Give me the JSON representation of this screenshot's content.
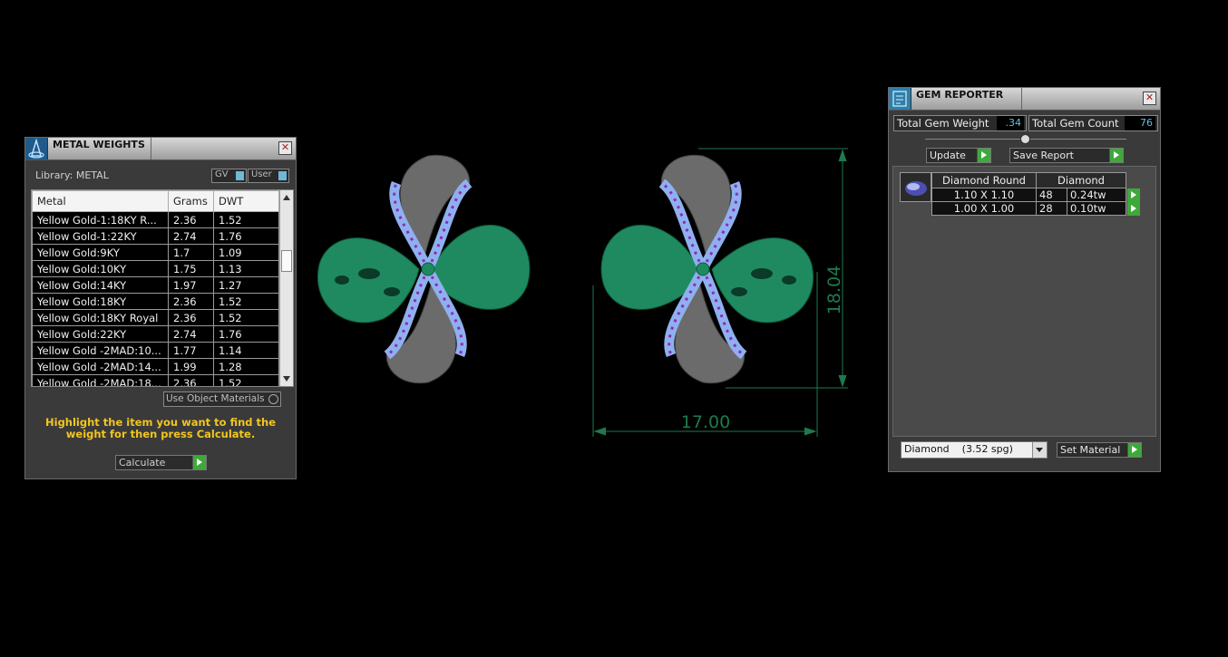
{
  "metal_weights": {
    "title": "METAL WEIGHTS",
    "library_label": "Library: METAL",
    "gv_label": "GV",
    "user_label": "User",
    "columns": [
      "Metal",
      "Grams",
      "DWT"
    ],
    "rows": [
      {
        "metal": "Yellow Gold-1:18KY R...",
        "grams": "2.36",
        "dwt": "1.52"
      },
      {
        "metal": "Yellow Gold-1:22KY",
        "grams": "2.74",
        "dwt": "1.76"
      },
      {
        "metal": "Yellow Gold:9KY",
        "grams": "1.7",
        "dwt": "1.09"
      },
      {
        "metal": "Yellow Gold:10KY",
        "grams": "1.75",
        "dwt": "1.13"
      },
      {
        "metal": "Yellow Gold:14KY",
        "grams": "1.97",
        "dwt": "1.27"
      },
      {
        "metal": "Yellow Gold:18KY",
        "grams": "2.36",
        "dwt": "1.52"
      },
      {
        "metal": "Yellow Gold:18KY Royal",
        "grams": "2.36",
        "dwt": "1.52"
      },
      {
        "metal": "Yellow Gold:22KY",
        "grams": "2.74",
        "dwt": "1.76"
      },
      {
        "metal": "Yellow Gold -2MAD:10...",
        "grams": "1.77",
        "dwt": "1.14"
      },
      {
        "metal": "Yellow Gold -2MAD:14...",
        "grams": "1.99",
        "dwt": "1.28"
      },
      {
        "metal": "Yellow Gold -2MAD:18...",
        "grams": "2.36",
        "dwt": "1.52"
      }
    ],
    "use_object_materials": "Use Object Materials",
    "instruction": "Highlight the item you want to find the weight for then press Calculate.",
    "calculate_label": "Calculate"
  },
  "gem_reporter": {
    "title": "GEM REPORTER",
    "total_weight_label": "Total Gem Weight",
    "total_weight_value": ".34",
    "total_count_label": "Total Gem Count",
    "total_count_value": "76",
    "update_label": "Update",
    "save_report_label": "Save Report",
    "table_headers": [
      "Diamond Round",
      "Diamond"
    ],
    "rows": [
      {
        "size": "1.10 X 1.10",
        "count": "48",
        "weight": "0.24tw"
      },
      {
        "size": "1.00 X 1.00",
        "count": "28",
        "weight": "0.10tw"
      }
    ],
    "material_select": "Diamond    (3.52 spg)",
    "set_material_label": "Set Material"
  },
  "viewport": {
    "dimension_height": "18.04",
    "dimension_width": "17.00",
    "colors": {
      "metal_green": "#1f8a60",
      "metal_gray": "#6b6b6b",
      "gem_blue": "#8fb0f0",
      "gem_purple": "#8a2fb0",
      "dimension": "#1d7a4e"
    }
  }
}
